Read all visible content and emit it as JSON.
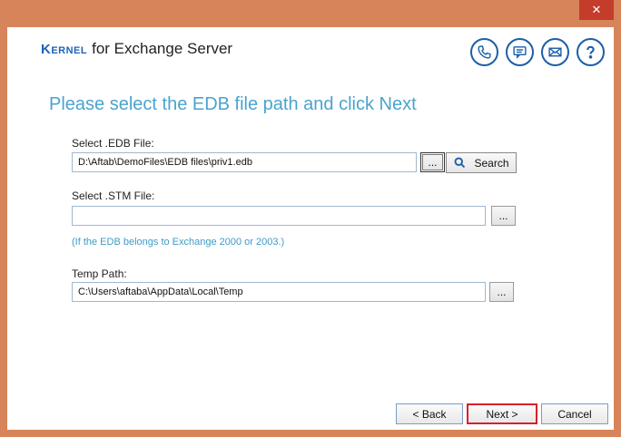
{
  "titlebar": {
    "close_label": "✕"
  },
  "brand": {
    "kernel": "Kernel",
    "rest": "for Exchange Server"
  },
  "header_icons": [
    "phone-icon",
    "chat-icon",
    "mail-icon",
    "help-icon"
  ],
  "heading": "Please select the EDB file path and click Next",
  "edb": {
    "label": "Select .EDB File:",
    "value": "D:\\Aftab\\DemoFiles\\EDB files\\priv1.edb",
    "browse_label": "...",
    "search_label": "Search"
  },
  "stm": {
    "label": "Select .STM File:",
    "value": "",
    "browse_label": "...",
    "note": "(If the EDB belongs to Exchange 2000 or 2003.)"
  },
  "temp": {
    "label": "Temp Path:",
    "value": "C:\\Users\\aftaba\\AppData\\Local\\Temp",
    "browse_label": "..."
  },
  "footer": {
    "back_label": "< Back",
    "next_label": "Next >",
    "cancel_label": "Cancel"
  },
  "colors": {
    "frame": "#d8845a",
    "accent": "#1d62b8",
    "heading": "#4aa3cf",
    "highlight": "#d8202a"
  }
}
